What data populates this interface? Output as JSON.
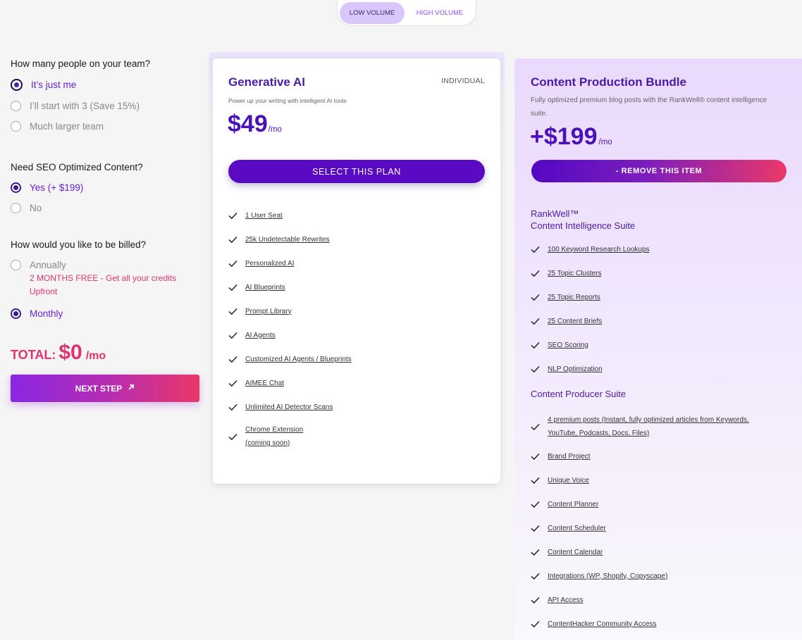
{
  "volume_toggle": {
    "options": [
      "LOW VOLUME",
      "HIGH VOLUME"
    ],
    "selected": "LOW VOLUME"
  },
  "left": {
    "team_question": "How many people on your team?",
    "team_options": [
      "It’s just me",
      "I’ll start with 3 (Save 15%)",
      "Much larger team"
    ],
    "team_selected": 0,
    "seo_question": "Need SEO Optimized Content?",
    "seo_options": [
      "Yes (+ $199)",
      "No"
    ],
    "seo_selected": 0,
    "billing_question": "How would you like to be billed?",
    "billing_options": [
      "Annually",
      "Monthly"
    ],
    "billing_promo": "2 MONTHS FREE - Get all your credits Upfront",
    "billing_selected": 1,
    "total_label": "TOTAL:",
    "total_amount": "$0",
    "total_period": "/mo",
    "next_label": "NEXT STEP"
  },
  "plan": {
    "title": "Generative AI",
    "tag": "INDIVIDUAL",
    "subtitle": "Power up your writing with intelligent AI tools",
    "price": "$49",
    "period": "/mo",
    "button": "SELECT THIS PLAN",
    "features": [
      "1 User Seat",
      "25k Undetectable Rewrites",
      "Personalized AI",
      "AI Blueprints",
      "Prompt Library",
      "AI Agents",
      "Customized AI Agents / Blueprints",
      "AIMEE Chat",
      "Unlimited AI Detector Scans",
      "Chrome Extension",
      "(coming soon)"
    ]
  },
  "bundle": {
    "title": "Content Production Bundle",
    "subtitle": "Fully optimized premium blog posts with the RankWell® content intelligence suite.",
    "price": "+$199",
    "period": "/mo",
    "button": "- REMOVE THIS ITEM",
    "section1_line1": "RankWell™",
    "section1_line2": "Content Intelligence Suite",
    "section1_features": [
      "100 Keyword Research Lookups",
      "25 Topic Clusters",
      "25 Topic Reports",
      "25 Content Briefs",
      "SEO Scoring",
      "NLP Optimization"
    ],
    "section2_title": "Content Producer Suite",
    "section2_first_line1": "4 premium posts  (Instant, fully optimized articles from Keywords,",
    "section2_first_line2": "YouTube, Podcasts, Docs, Files)",
    "section2_features": [
      "Brand Project",
      "Unique Voice",
      "Content Planner",
      "Content Scheduler",
      "Content Calendar",
      "Integrations (WP, Shopify, Copyscape)",
      "API Access",
      "ContentHacker Community Access"
    ]
  }
}
